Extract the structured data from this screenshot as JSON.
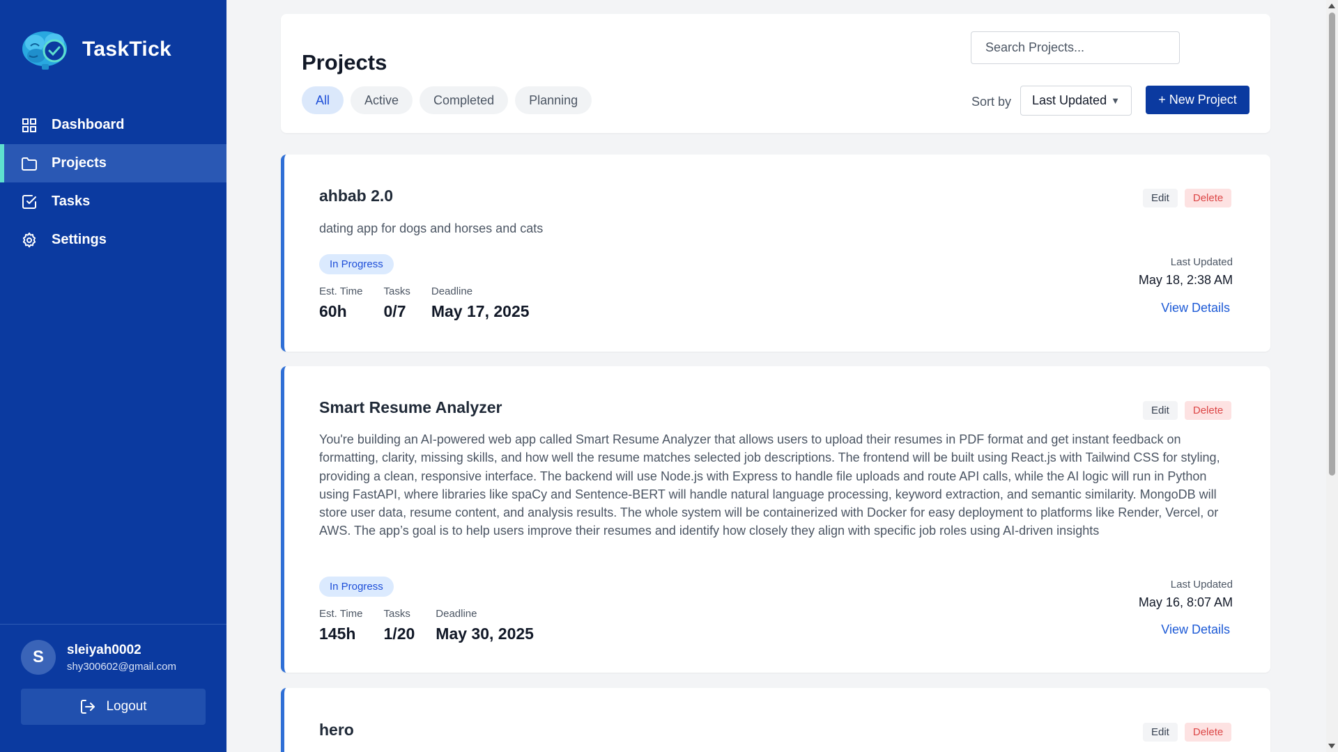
{
  "brand": {
    "name": "TaskTick",
    "logo_icon": "brain-clock-icon"
  },
  "sidebar": {
    "items": [
      {
        "label": "Dashboard",
        "icon": "grid-icon",
        "active": false
      },
      {
        "label": "Projects",
        "icon": "folder-icon",
        "active": true
      },
      {
        "label": "Tasks",
        "icon": "checkbox-icon",
        "active": false
      },
      {
        "label": "Settings",
        "icon": "gear-icon",
        "active": false
      }
    ],
    "user": {
      "initial": "S",
      "name": "sleiyah0002",
      "email": "shy300602@gmail.com"
    },
    "logout_label": "Logout"
  },
  "header": {
    "title": "Projects",
    "search_placeholder": "Search Projects...",
    "filters": [
      "All",
      "Active",
      "Completed",
      "Planning"
    ],
    "active_filter": "All",
    "sort_label": "Sort by",
    "sort_value": "Last Updated",
    "new_button": "+ New Project"
  },
  "projects": [
    {
      "title": "ahbab 2.0",
      "description": "dating app for dogs and horses and cats",
      "status": "In Progress",
      "est_time_label": "Est. Time",
      "est_time": "60h",
      "tasks_label": "Tasks",
      "tasks": "0/7",
      "deadline_label": "Deadline",
      "deadline": "May 17, 2025",
      "updated_label": "Last Updated",
      "updated": "May 18, 2:38 AM",
      "edit": "Edit",
      "delete": "Delete",
      "view": "View Details"
    },
    {
      "title": "Smart Resume Analyzer",
      "description": "You're building an AI-powered web app called Smart Resume Analyzer that allows users to upload their resumes in PDF format and get instant feedback on formatting, clarity, missing skills, and how well the resume matches selected job descriptions. The frontend will be built using React.js with Tailwind CSS for styling, providing a clean, responsive interface. The backend will use Node.js with Express to handle file uploads and route API calls, while the AI logic will run in Python using FastAPI, where libraries like spaCy and Sentence-BERT will handle natural language processing, keyword extraction, and semantic similarity. MongoDB will store user data, resume content, and analysis results. The whole system will be containerized with Docker for easy deployment to platforms like Render, Vercel, or AWS. The app’s goal is to help users improve their resumes and identify how closely they align with specific job roles using AI-driven insights",
      "status": "In Progress",
      "est_time_label": "Est. Time",
      "est_time": "145h",
      "tasks_label": "Tasks",
      "tasks": "1/20",
      "deadline_label": "Deadline",
      "deadline": "May 30, 2025",
      "updated_label": "Last Updated",
      "updated": "May 16, 8:07 AM",
      "edit": "Edit",
      "delete": "Delete",
      "view": "View Details"
    },
    {
      "title": "hero",
      "edit": "Edit",
      "delete": "Delete"
    }
  ],
  "colors": {
    "sidebar": "#0b3aa0",
    "accent": "#2f6fd6",
    "active_indicator": "#5ee0cf",
    "delete": "#dc4646"
  }
}
